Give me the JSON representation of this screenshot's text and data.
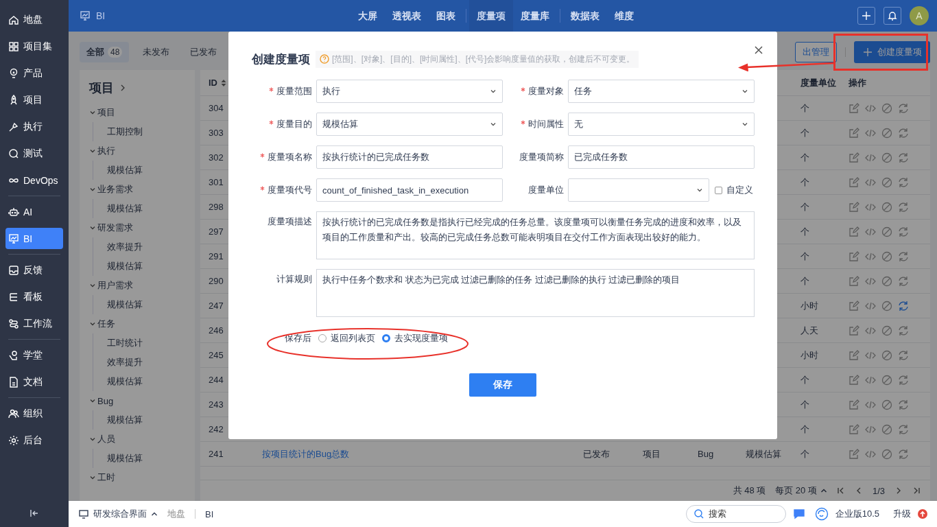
{
  "sidebar": {
    "sections": [
      {
        "items": [
          {
            "label": "地盘",
            "selected": false
          },
          {
            "label": "项目集",
            "selected": false
          },
          {
            "label": "产品",
            "selected": false
          },
          {
            "label": "项目",
            "selected": false
          },
          {
            "label": "执行",
            "selected": false
          },
          {
            "label": "测试",
            "selected": false
          },
          {
            "label": "DevOps",
            "selected": false
          }
        ]
      },
      {
        "items": [
          {
            "label": "AI",
            "selected": false
          },
          {
            "label": "BI",
            "selected": true
          }
        ]
      },
      {
        "items": [
          {
            "label": "反馈",
            "selected": false
          },
          {
            "label": "看板",
            "selected": false
          },
          {
            "label": "工作流",
            "selected": false
          }
        ]
      },
      {
        "items": [
          {
            "label": "学堂",
            "selected": false
          },
          {
            "label": "文档",
            "selected": false
          }
        ]
      },
      {
        "items": [
          {
            "label": "组织",
            "selected": false
          },
          {
            "label": "后台",
            "selected": false
          }
        ]
      }
    ]
  },
  "topbar": {
    "app": "BI",
    "nav_groups": [
      [
        {
          "label": "大屏",
          "selected": false
        },
        {
          "label": "透视表",
          "selected": false
        },
        {
          "label": "图表",
          "selected": false
        }
      ],
      [
        {
          "label": "度量项",
          "selected": true
        },
        {
          "label": "度量库",
          "selected": false
        }
      ],
      [
        {
          "label": "数据表",
          "selected": false
        },
        {
          "label": "维度",
          "selected": false
        }
      ]
    ],
    "avatar": "A"
  },
  "filters": {
    "tabs": [
      {
        "label": "全部",
        "count": "48",
        "selected": true
      },
      {
        "label": "未发布",
        "selected": false
      },
      {
        "label": "已发布",
        "selected": false
      }
    ],
    "manage_button": "出管理",
    "create_button": "创建度量项"
  },
  "tree": {
    "title": "项目",
    "groups": [
      {
        "label": "项目",
        "expanded": true,
        "children": [
          {
            "label": "工期控制"
          }
        ]
      },
      {
        "label": "执行",
        "expanded": true,
        "children": [
          {
            "label": "规模估算"
          }
        ]
      },
      {
        "label": "业务需求",
        "expanded": true,
        "children": [
          {
            "label": "规模估算"
          }
        ]
      },
      {
        "label": "研发需求",
        "expanded": true,
        "children": [
          {
            "label": "效率提升"
          },
          {
            "label": "规模估算"
          }
        ]
      },
      {
        "label": "用户需求",
        "expanded": true,
        "children": [
          {
            "label": "规模估算"
          }
        ]
      },
      {
        "label": "任务",
        "expanded": true,
        "children": [
          {
            "label": "工时统计"
          },
          {
            "label": "效率提升"
          },
          {
            "label": "规模估算"
          }
        ]
      },
      {
        "label": "Bug",
        "expanded": true,
        "children": [
          {
            "label": "规模估算"
          }
        ]
      },
      {
        "label": "人员",
        "expanded": true,
        "children": [
          {
            "label": "规模估算"
          }
        ]
      },
      {
        "label": "工时",
        "expanded": true
      }
    ]
  },
  "table": {
    "header_id": "ID",
    "header_unit": "度量单位",
    "header_actions": "操作",
    "rows": [
      {
        "id": "304",
        "unit": "个",
        "refresh_highlighted": false
      },
      {
        "id": "303",
        "unit": "个",
        "refresh_highlighted": false
      },
      {
        "id": "302",
        "unit": "个",
        "refresh_highlighted": false
      },
      {
        "id": "301",
        "unit": "个",
        "refresh_highlighted": false
      },
      {
        "id": "298",
        "unit": "个",
        "refresh_highlighted": false
      },
      {
        "id": "297",
        "unit": "个",
        "refresh_highlighted": false
      },
      {
        "id": "291",
        "unit": "个",
        "refresh_highlighted": false
      },
      {
        "id": "290",
        "unit": "个",
        "refresh_highlighted": false
      },
      {
        "id": "247",
        "unit": "小时",
        "refresh_highlighted": true
      },
      {
        "id": "246",
        "unit": "人天",
        "refresh_highlighted": false
      },
      {
        "id": "245",
        "unit": "小时",
        "refresh_highlighted": false
      },
      {
        "id": "244",
        "unit": "个",
        "refresh_highlighted": false
      },
      {
        "id": "243",
        "unit": "个",
        "refresh_highlighted": false
      },
      {
        "id": "242",
        "unit": "个",
        "refresh_highlighted": false
      },
      {
        "id": "241",
        "name": "按项目统计的Bug总数",
        "status": "已发布",
        "scope": "项目",
        "object": "Bug",
        "purpose": "规模估算",
        "unit": "个",
        "refresh_highlighted": false
      }
    ],
    "pagination": {
      "total": "共 48 项",
      "per_page": "每页 20 项",
      "page": "1/3"
    }
  },
  "modal": {
    "title": "创建度量项",
    "hint": "[范围]、[对象]、[目的]、[时间属性]、[代号]会影响度量值的获取，创建后不可变更。",
    "fields": [
      {
        "kind": "select",
        "label": "度量范围",
        "required": true,
        "value": "执行"
      },
      {
        "kind": "select",
        "label": "度量对象",
        "required": true,
        "value": "任务"
      },
      {
        "kind": "select",
        "label": "度量目的",
        "required": true,
        "value": "规模估算"
      },
      {
        "kind": "select",
        "label": "时间属性",
        "required": true,
        "value": "无"
      },
      {
        "kind": "input",
        "label": "度量项名称",
        "required": true,
        "value": "按执行统计的已完成任务数"
      },
      {
        "kind": "input",
        "label": "度量项简称",
        "required": false,
        "value": "已完成任务数"
      },
      {
        "kind": "input",
        "label": "度量项代号",
        "required": true,
        "value": "count_of_finished_task_in_execution"
      },
      {
        "kind": "unit",
        "label": "度量单位",
        "required": false,
        "checkbox_label": "自定义",
        "checked": false
      },
      {
        "kind": "textarea",
        "label": "度量项描述",
        "required": false,
        "value": "按执行统计的已完成任务数是指执行已经完成的任务总量。该度量项可以衡量任务完成的进度和效率，以及项目的工作质量和产出。较高的已完成任务总数可能表明项目在交付工作方面表现出较好的能力。"
      },
      {
        "kind": "textarea",
        "label": "计算规则",
        "required": false,
        "value": "执行中任务个数求和 状态为已完成 过滤已删除的任务 过滤已删除的执行 过滤已删除的项目"
      }
    ],
    "after_save": {
      "label": "保存后",
      "options": [
        {
          "label": "返回列表页",
          "selected": false
        },
        {
          "label": "去实现度量项",
          "selected": true
        }
      ]
    },
    "save_button": "保存"
  },
  "bottombar": {
    "workspace": "研发综合界面",
    "breadcrumb": [
      "地盘",
      "BI"
    ],
    "search_placeholder": "搜索",
    "edition": "企业版10.5",
    "upgrade": "升级"
  }
}
